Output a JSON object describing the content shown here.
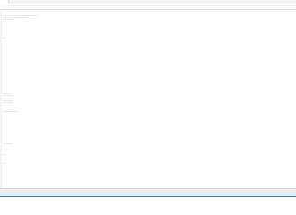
{
  "tab": {
    "title": ""
  },
  "status": {
    "text": ""
  },
  "colors": {
    "accent": "#e8541d",
    "status_accent": "#2c86d9"
  },
  "editor": {
    "lines": [
      "————————————————————————————————",
      "——————————————————————",
      "———————————",
      "——",
      "———",
      "———————",
      "——————————",
      "——————————",
      "——————————",
      "——————————————",
      "—————————",
      "——",
      "———",
      "———",
      "—————"
    ]
  }
}
